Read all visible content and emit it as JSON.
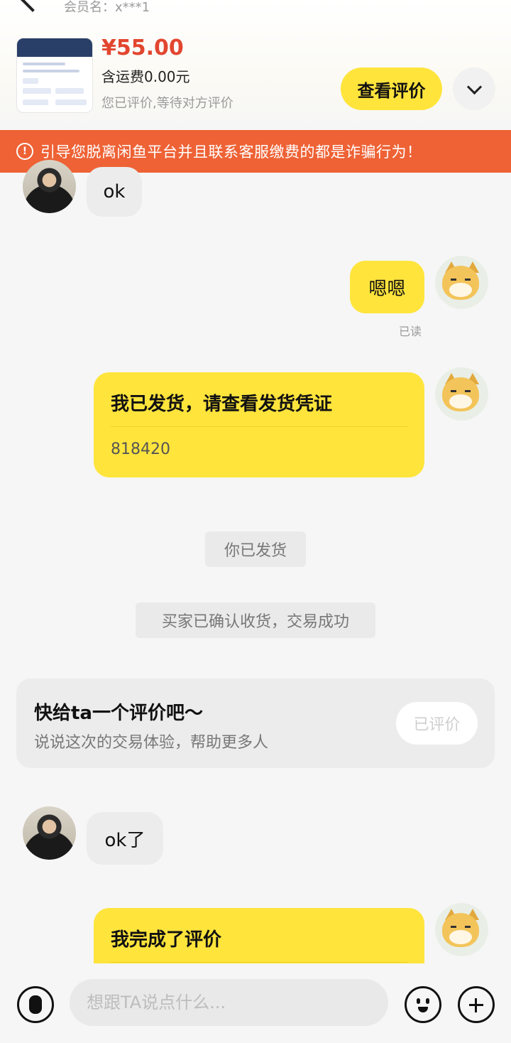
{
  "header": {
    "member_name": "会员名：x***1",
    "price": "¥55.00",
    "shipping": "含运费0.00元",
    "status": "您已评价,等待对方评价",
    "view_review_label": "查看评价"
  },
  "warning": {
    "text": "引导您脱离闲鱼平台并且联系客服缴费的都是诈骗行为！",
    "icon": "!"
  },
  "messages": {
    "m1": "ok",
    "m2": "嗯嗯",
    "m2_read": "已读",
    "shipment_title": "我已发货，请查看发货凭证",
    "shipment_code": "818420",
    "sys1": "你已发货",
    "sys2": "买家已确认收货，交易成功",
    "m3": "ok了",
    "review_done_title": "我完成了评价"
  },
  "review_prompt": {
    "title": "快给ta一个评价吧～",
    "subtitle": "说说这次的交易体验，帮助更多人",
    "button": "已评价"
  },
  "input": {
    "placeholder": "想跟TA说点什么..."
  },
  "colors": {
    "accent": "#ffe43c",
    "price": "#e2462f",
    "warning_bg": "#ee6235"
  }
}
